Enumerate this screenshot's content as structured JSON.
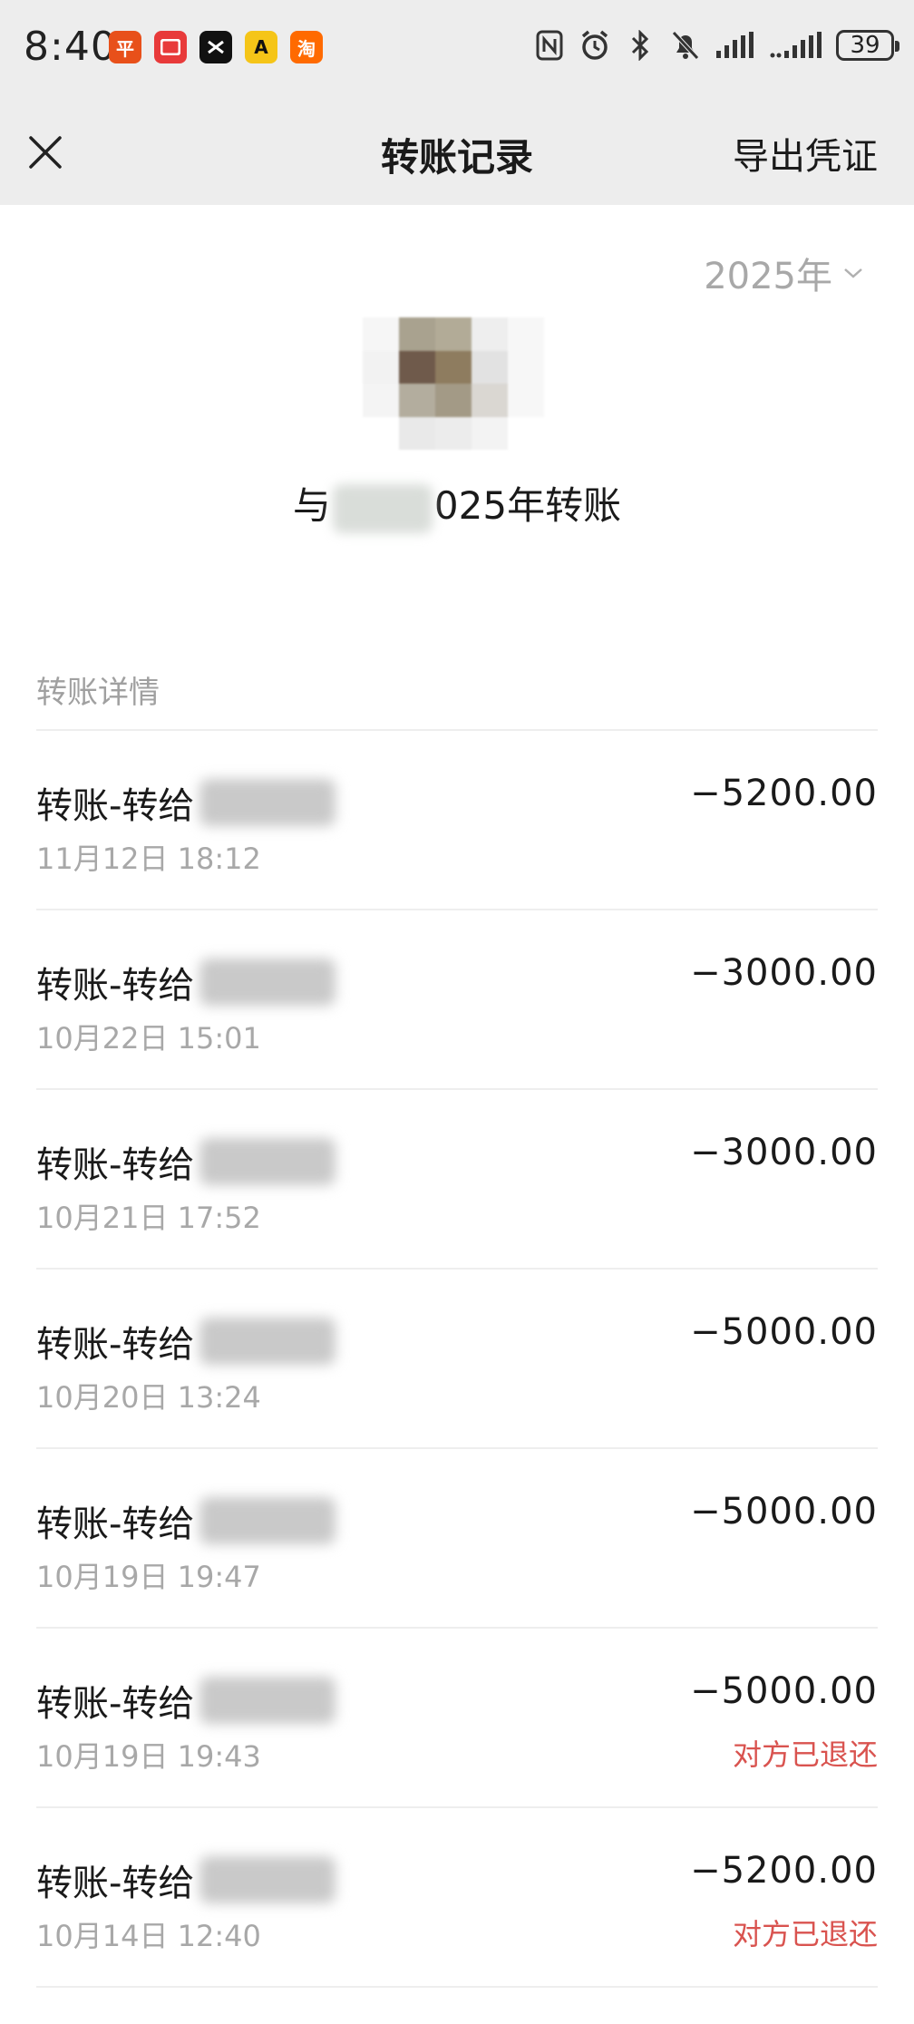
{
  "status_bar": {
    "time": "8:40",
    "app_icons": [
      {
        "name": "pingan-bank-icon",
        "glyph": "平",
        "color": "#e8501a"
      },
      {
        "name": "red-app-icon",
        "glyph": "▢",
        "color": "#e83a3a"
      },
      {
        "name": "capcut-icon",
        "glyph": "✕",
        "color": "#111111"
      },
      {
        "name": "yellow-a-app-icon",
        "glyph": "A",
        "color": "#f5c518"
      },
      {
        "name": "taobao-icon",
        "glyph": "淘",
        "color": "#ff6a00"
      }
    ],
    "battery": "39"
  },
  "header": {
    "title": "转账记录",
    "export_label": "导出凭证"
  },
  "year_selector": {
    "label": "2025年"
  },
  "summary": {
    "prefix": "与",
    "suffix": "025年转账"
  },
  "section": {
    "label": "转账详情"
  },
  "transactions": [
    {
      "title": "转账-转给",
      "time": "11月12日 18:12",
      "amount": "−5200.00",
      "status": ""
    },
    {
      "title": "转账-转给",
      "time": "10月22日 15:01",
      "amount": "−3000.00",
      "status": ""
    },
    {
      "title": "转账-转给",
      "time": "10月21日 17:52",
      "amount": "−3000.00",
      "status": ""
    },
    {
      "title": "转账-转给",
      "time": "10月20日 13:24",
      "amount": "−5000.00",
      "status": ""
    },
    {
      "title": "转账-转给",
      "time": "10月19日 19:47",
      "amount": "−5000.00",
      "status": ""
    },
    {
      "title": "转账-转给",
      "time": "10月19日 19:43",
      "amount": "−5000.00",
      "status": "对方已退还"
    },
    {
      "title": "转账-转给",
      "time": "10月14日 12:40",
      "amount": "−5200.00",
      "status": "对方已退还"
    }
  ],
  "colors": {
    "header_bg": "#ededed",
    "refund_status": "#d9534f",
    "muted_text": "#a8a8a8"
  }
}
